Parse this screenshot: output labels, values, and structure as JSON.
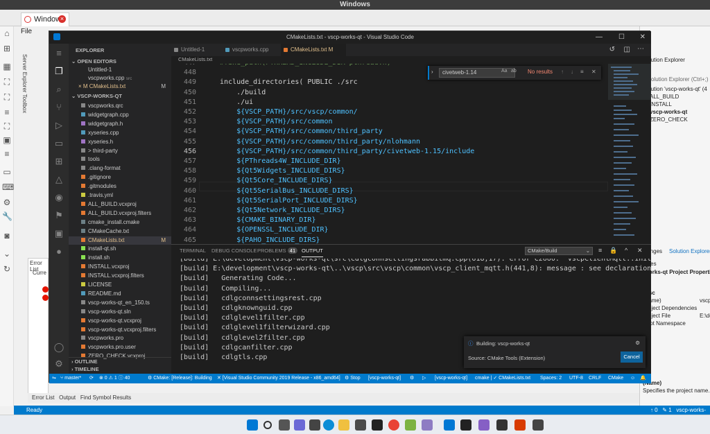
{
  "os": {
    "title": "Windows"
  },
  "host": {
    "tab_label": "Windows",
    "menu_file": "File",
    "side_labels": "Server Explorer   Toolbox",
    "solution_explorer": {
      "title": "Solution Explorer",
      "search": "h Solution Explorer (Ctrl+;)",
      "solution": "Solution 'vscp-works-qt' (4",
      "items": [
        "ALL_BUILD",
        "INSTALL",
        "vscp-works-qt",
        "ZERO_CHECK"
      ],
      "tabs": [
        "Changes",
        "Solution Explorer"
      ],
      "properties_title": "erties",
      "properties_header": "-works-qt  Project Properties",
      "prop_rows": [
        {
          "k": "Misc",
          "v": ""
        },
        {
          "k": "(Name)",
          "v": "vscp"
        },
        {
          "k": "Project Dependencies",
          "v": ""
        },
        {
          "k": "Project File",
          "v": "E:\\de"
        },
        {
          "k": "Root Namespace",
          "v": ""
        }
      ],
      "name_label": "(Name)",
      "name_desc": "Specifies the project name."
    },
    "error_list": {
      "title": "Error List",
      "current": "Curre"
    },
    "bottom_tabs": [
      "Error List",
      "Output",
      "Find Symbol Results"
    ],
    "status": {
      "ready": "Ready",
      "arrows": "↑ 0",
      "pencil": "✎ 1",
      "branch": "vscp-works-"
    }
  },
  "vscode": {
    "title": "CMakeLists.txt - vscp-works-qt - Visual Studio Code",
    "tabs": [
      {
        "label": "Untitled-1",
        "active": false
      },
      {
        "label": "vscpworks.cpp",
        "active": false
      },
      {
        "label": "CMakeLists.txt  M",
        "active": true
      }
    ],
    "breadcrumb": "CMakeLists.txt",
    "explorer": {
      "title": "EXPLORER",
      "open_editors": "OPEN EDITORS",
      "open_items": [
        {
          "label": "Untitled-1",
          "extra": ""
        },
        {
          "label": "vscpworks.cpp",
          "extra": "src"
        },
        {
          "label": "× M CMakeLists.txt",
          "extra": "M"
        }
      ],
      "project": "VSCP-WORKS-QT",
      "files": [
        {
          "label": "vscpworks.qrc",
          "badge": ""
        },
        {
          "label": "widgetgraph.cpp",
          "badge": ""
        },
        {
          "label": "widgetgraph.h",
          "badge": ""
        },
        {
          "label": "xyseries.cpp",
          "badge": ""
        },
        {
          "label": "xyseries.h",
          "badge": ""
        },
        {
          "label": "> third-party",
          "badge": ""
        },
        {
          "label": "tools",
          "badge": ""
        },
        {
          "label": ".clang-format",
          "badge": ""
        },
        {
          "label": ".gitignore",
          "badge": ""
        },
        {
          "label": ".gitmodules",
          "badge": ""
        },
        {
          "label": ".travis.yml",
          "badge": ""
        },
        {
          "label": "ALL_BUILD.vcxproj",
          "badge": ""
        },
        {
          "label": "ALL_BUILD.vcxproj.filters",
          "badge": ""
        },
        {
          "label": "cmake_install.cmake",
          "badge": ""
        },
        {
          "label": "CMakeCache.txt",
          "badge": ""
        },
        {
          "label": "CMakeLists.txt",
          "badge": "M"
        },
        {
          "label": "install-qt.sh",
          "badge": ""
        },
        {
          "label": "install.sh",
          "badge": ""
        },
        {
          "label": "INSTALL.vcxproj",
          "badge": ""
        },
        {
          "label": "INSTALL.vcxproj.filters",
          "badge": ""
        },
        {
          "label": "LICENSE",
          "badge": ""
        },
        {
          "label": "README.md",
          "badge": ""
        },
        {
          "label": "vscp-works-qt_en_150.ts",
          "badge": ""
        },
        {
          "label": "vscp-works-qt.sln",
          "badge": ""
        },
        {
          "label": "vscp-works-qt.vcxproj",
          "badge": ""
        },
        {
          "label": "vscp-works-qt.vcxproj.filters",
          "badge": ""
        },
        {
          "label": "vscpworks.pro",
          "badge": ""
        },
        {
          "label": "vscpworks.pro.user",
          "badge": ""
        },
        {
          "label": "ZERO_CHECK.vcxproj",
          "badge": ""
        }
      ],
      "outline": "OUTLINE",
      "timeline": "TIMELINE"
    },
    "find": {
      "query": "civetweb-1.14",
      "result": "No results"
    },
    "code_lines": [
      {
        "n": "447",
        "text": "#find_path(PTHREAD_INCLUDE_DIR pthread.h)"
      },
      {
        "n": "448",
        "text": ""
      },
      {
        "n": "449",
        "text": "include_directories( PUBLIC ./src"
      },
      {
        "n": "450",
        "text": "    ./build"
      },
      {
        "n": "451",
        "text": "    ./ui"
      },
      {
        "n": "452",
        "text": "    ${VSCP_PATH}/src/vscp/common/"
      },
      {
        "n": "453",
        "text": "    ${VSCP_PATH}/src/common"
      },
      {
        "n": "454",
        "text": "    ${VSCP_PATH}/src/common/third_party"
      },
      {
        "n": "455",
        "text": "    ${VSCP_PATH}/src/common/third_party/nlohmann"
      },
      {
        "n": "456",
        "text": "    ${VSCP_PATH}/src/common/third_party/civetweb-1.15/include"
      },
      {
        "n": "457",
        "text": "    ${PThreads4W_INCLUDE_DIR}"
      },
      {
        "n": "458",
        "text": "    ${Qt5Widgets_INCLUDE_DIRS}"
      },
      {
        "n": "459",
        "text": "    ${Qt5Core_INCLUDE_DIRS}"
      },
      {
        "n": "460",
        "text": "    ${Qt5SerialBus_INCLUDE_DIRS}"
      },
      {
        "n": "461",
        "text": "    ${Qt5SerialPort_INCLUDE_DIRS}"
      },
      {
        "n": "462",
        "text": "    ${Qt5Network_INCLUDE_DIRS}"
      },
      {
        "n": "463",
        "text": "    ${CMAKE_BINARY_DIR}"
      },
      {
        "n": "464",
        "text": "    ${OPENSSL_INCLUDE_DIR}"
      },
      {
        "n": "465",
        "text": "    ${PAHO_INCLUDE_DIRS}"
      }
    ],
    "current_line": "456",
    "panel": {
      "tabs": [
        "TERMINAL",
        "DEBUG CONSOLE",
        "PROBLEMS",
        "OUTPUT"
      ],
      "problems_count": "41",
      "select": "CMake/Build",
      "lines": [
        "[build] E:\\development\\vscp-works-qt\\src\\cdlgconnsettingsrabbitmq.cpp(618,17): error C2660: 'vscpClientMqtt::init': f",
        "[build] E:\\development\\vscp-works-qt\\..\\vscp\\src\\vscp\\common\\vscp_client_mqtt.h(441,8): message : see declaration of",
        "[build]   Generating Code...",
        "[build]   Compiling...",
        "[build]   cdlgconnsettingsrest.cpp",
        "[build]   cdlgknownguid.cpp",
        "[build]   cdlglevel1filter.cpp",
        "[build]   cdlglevel1filterwizard.cpp",
        "[build]   cdlglevel2filter.cpp",
        "[build]   cdlgcanfilter.cpp",
        "[build]   cdlgtls.cpp"
      ]
    },
    "notification": {
      "title": "Building: vscp-works-qt",
      "source": "Source: CMake Tools (Extension)",
      "cancel": "Cancel"
    },
    "status": {
      "branch": "master*",
      "sync": "⟳",
      "problems": "⊗ 0 ⚠ 1 ⓘ 40",
      "cmake": "CMake: [Release]: Building",
      "kit": "[Visual Studio Community 2019 Release - x86_amd64]",
      "stop": "Stop",
      "target": "[vscp-works-qt]",
      "debug": "⚙",
      "run": "▷",
      "launch": "[vscp-works-qt]",
      "cmake_file": "cmake | ✓ CMakeLists.txt",
      "spaces": "Spaces: 2",
      "encoding": "UTF-8",
      "eol": "CRLF",
      "lang": "CMake"
    }
  },
  "colors": {
    "accent": "#007acc",
    "editor_bg": "#1e1e1e",
    "sidebar_bg": "#252526",
    "modified": "#e2c08d"
  }
}
